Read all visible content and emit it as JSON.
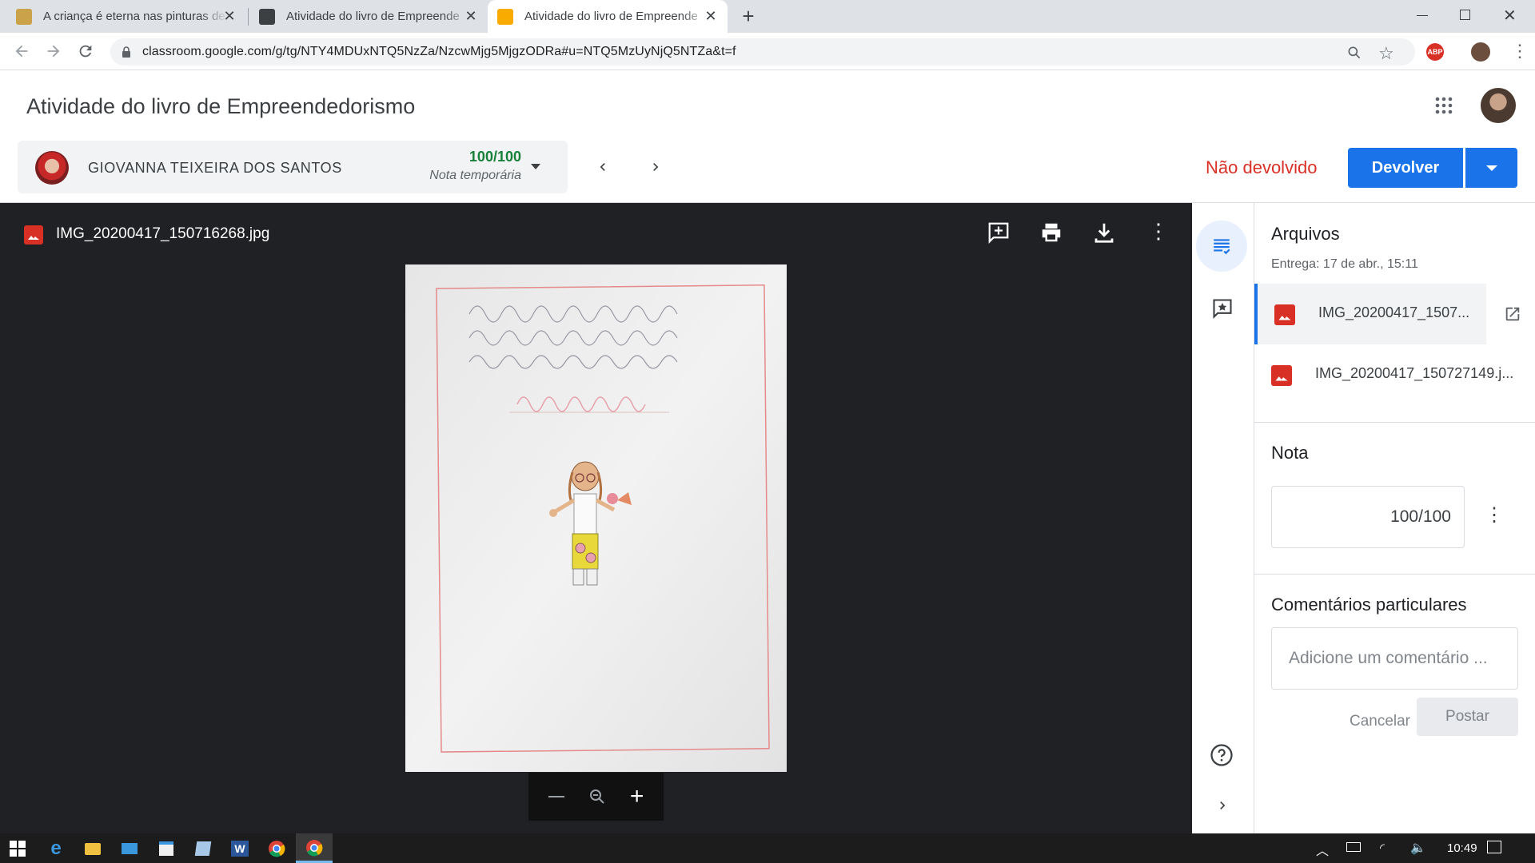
{
  "browser": {
    "tabs": [
      {
        "title": "A criança é eterna nas pinturas de",
        "favicon_color": "#b8860b"
      },
      {
        "title": "Atividade do livro de Empreende",
        "favicon_color": "#3c4043"
      },
      {
        "title": "Atividade do livro de Empreende",
        "favicon_color": "#f9ab00"
      }
    ],
    "url": "classroom.google.com/g/tg/NTY4MDUxNTQ5NzZa/NzcwMjg5MjgzODRa#u=NTQ5MzUyNjQ5NTZa&t=f"
  },
  "header": {
    "title": "Atividade do livro de Empreendedorismo",
    "student_name": "GIOVANNA TEIXEIRA DOS SANTOS",
    "grade": "100/100",
    "grade_note": "Nota temporária",
    "status": "Não devolvido",
    "return_label": "Devolver"
  },
  "viewer": {
    "file_name": "IMG_20200417_150716268.jpg"
  },
  "panel": {
    "files_title": "Arquivos",
    "delivered": "Entrega: 17 de abr., 15:11",
    "files": [
      {
        "name": "IMG_20200417_1507..."
      },
      {
        "name": "IMG_20200417_150727149.j..."
      }
    ],
    "grade_title": "Nota",
    "grade_value": "100/100",
    "comments_title": "Comentários particulares",
    "comment_placeholder": "Adicione um comentário ...",
    "cancel_label": "Cancelar",
    "post_label": "Postar"
  },
  "taskbar": {
    "clock": "10:49"
  },
  "colors": {
    "accent": "#1a73e8",
    "grade_green": "#188038",
    "status_red": "#d93025"
  }
}
